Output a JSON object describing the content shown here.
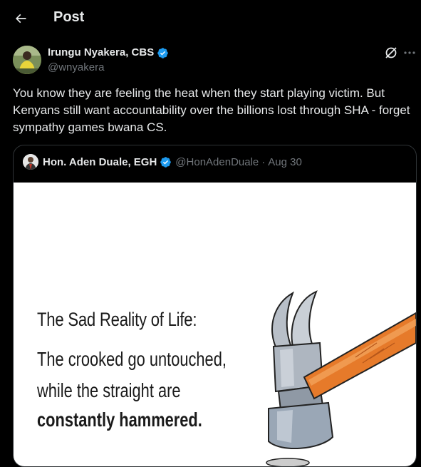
{
  "header": {
    "title": "Post"
  },
  "tweet": {
    "author_name": "Irungu Nyakera, CBS",
    "author_handle": "@wnyakera",
    "text": "You know they are feeling the heat when they start playing victim. But Kenyans still want accountability over the billions lost through SHA - forget sympathy games bwana CS."
  },
  "quote": {
    "author_name": "Hon. Aden Duale, EGH",
    "author_handle": "@HonAdenDuale",
    "separator": "·",
    "date": "Aug 30",
    "image": {
      "heading": "The Sad Reality of Life:",
      "line1": "The crooked go untouched,",
      "line2": "while the straight are",
      "line3": "constantly hammered."
    }
  },
  "colors": {
    "background": "#000000",
    "text_primary": "#e7e9ea",
    "text_secondary": "#71767b",
    "verified_blue": "#1d9bf0",
    "border": "#2f3336"
  },
  "icons": {
    "back": "arrow-left-icon",
    "verified": "verified-badge-icon",
    "grok": "grok-icon",
    "more": "more-horizontal-icon"
  }
}
